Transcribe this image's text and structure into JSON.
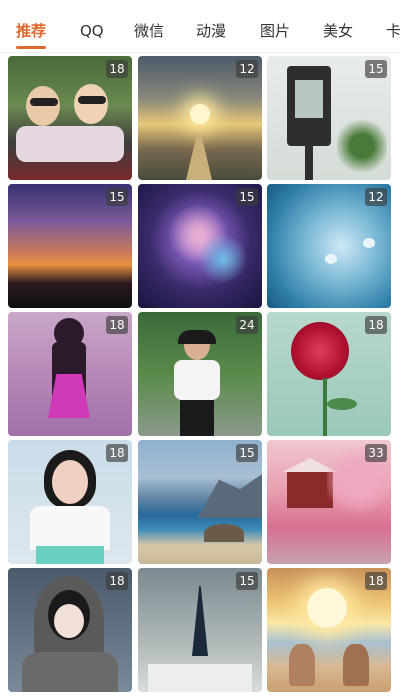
{
  "tabs": [
    {
      "label": "推荐",
      "active": true
    },
    {
      "label": "QQ"
    },
    {
      "label": "微信"
    },
    {
      "label": "动漫"
    },
    {
      "label": "图片"
    },
    {
      "label": "美女"
    },
    {
      "label": "卡"
    }
  ],
  "grid": {
    "items": [
      {
        "count": "18",
        "theme": "two-girls-sunglasses"
      },
      {
        "count": "12",
        "theme": "sunset-coast"
      },
      {
        "count": "15",
        "theme": "lantern-leaves"
      },
      {
        "count": "15",
        "theme": "dark-sunset"
      },
      {
        "count": "15",
        "theme": "galaxy-art"
      },
      {
        "count": "12",
        "theme": "blue-hearts"
      },
      {
        "count": "18",
        "theme": "angel-wings-girl"
      },
      {
        "count": "24",
        "theme": "girl-by-fence"
      },
      {
        "count": "18",
        "theme": "red-rose"
      },
      {
        "count": "18",
        "theme": "girl-braids"
      },
      {
        "count": "15",
        "theme": "cliff-beach"
      },
      {
        "count": "33",
        "theme": "pink-trees-house"
      },
      {
        "count": "18",
        "theme": "girl-hood-snow"
      },
      {
        "count": "15",
        "theme": "eiffel-snow"
      },
      {
        "count": "18",
        "theme": "sunset-couple"
      }
    ]
  },
  "colors": {
    "accent": "#e06a2e",
    "badge_bg": "rgba(60,60,60,0.65)"
  }
}
